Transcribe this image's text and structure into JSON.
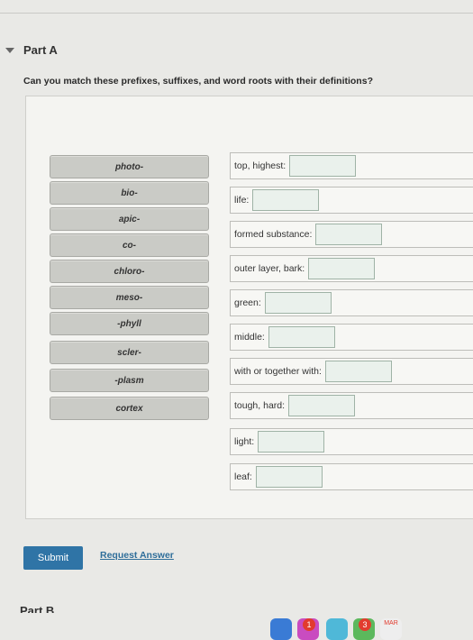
{
  "part": {
    "title": "Part A"
  },
  "question": "Can you match these prefixes, suffixes, and word roots with their definitions?",
  "terms": [
    "photo-",
    "bio-",
    "apic-",
    "co-",
    "chloro-",
    "meso-",
    "-phyll",
    "scler-",
    "-plasm",
    "cortex"
  ],
  "definitions": [
    "top, highest:",
    "life:",
    "formed substance:",
    "outer layer, bark:",
    "green:",
    "middle:",
    "with or together with:",
    "tough, hard:",
    "light:",
    "leaf:"
  ],
  "buttons": {
    "submit": "Submit",
    "request_answer": "Request Answer"
  },
  "next_part_partial": "Part B",
  "dock": {
    "badges": [
      "1",
      "3"
    ],
    "calendar_label": "MAR"
  },
  "colors": {
    "accent": "#2f74a6",
    "link": "#2f6e9a",
    "drop_target": "#eaf1ec"
  }
}
